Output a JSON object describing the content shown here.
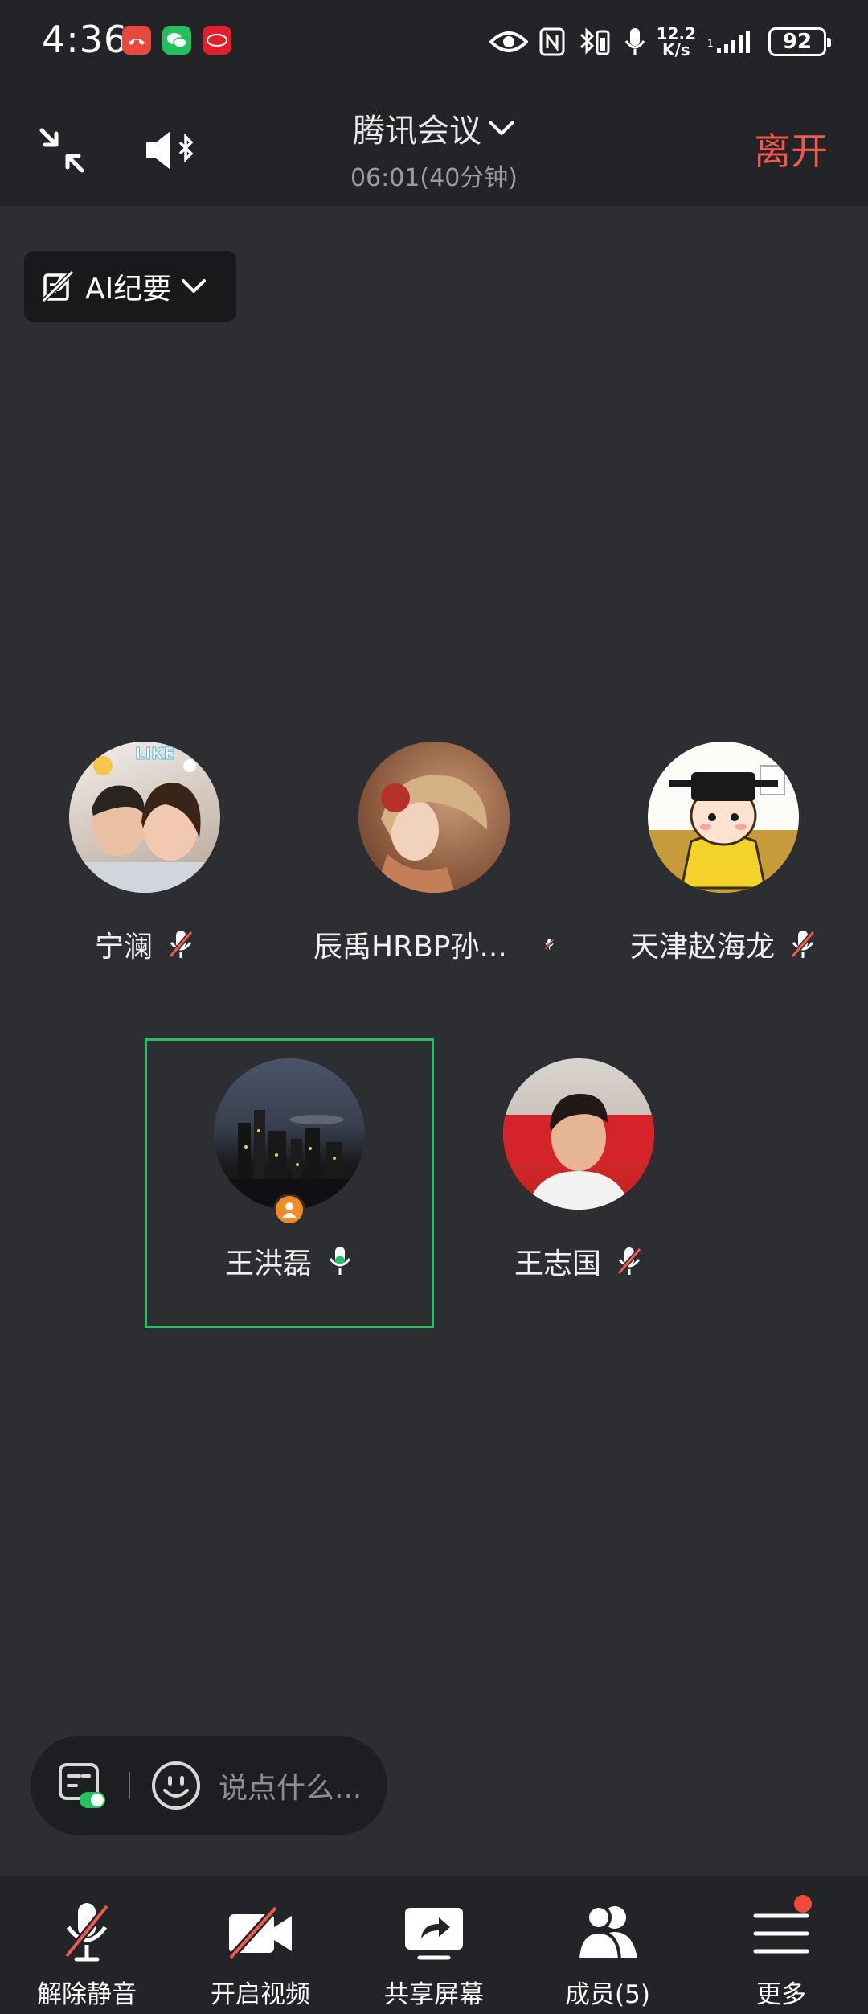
{
  "status_bar": {
    "time": "4:36",
    "net_speed_value": "12.2",
    "net_speed_unit": "K/s",
    "battery": "92"
  },
  "header": {
    "title": "腾讯会议",
    "duration": "06:01(40分钟)",
    "leave_label": "离开"
  },
  "ai_summary": {
    "label": "AI纪要"
  },
  "participants": [
    {
      "name": "宁澜",
      "mic": "muted"
    },
    {
      "name": "辰禹HRBP孙...",
      "mic": "muted"
    },
    {
      "name": "天津赵海龙",
      "mic": "muted"
    },
    {
      "name": "王洪磊",
      "mic": "on",
      "host": true,
      "speaking": true
    },
    {
      "name": "王志国",
      "mic": "muted"
    }
  ],
  "chat": {
    "placeholder": "说点什么..."
  },
  "toolbar": {
    "unmute": "解除静音",
    "video": "开启视频",
    "share": "共享屏幕",
    "members": "成员(5)",
    "more": "更多"
  },
  "colors": {
    "accent_leave": "#f0584c",
    "speaking_border": "#22c35e",
    "mic_on": "#22c35e",
    "badge_red": "#f04a3a"
  }
}
